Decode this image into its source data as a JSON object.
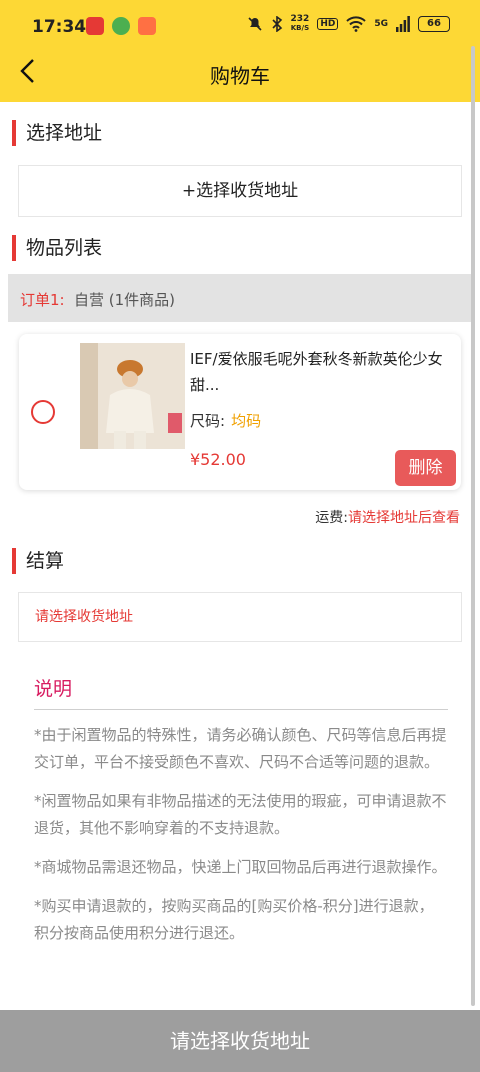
{
  "status_bar": {
    "time": "17:34",
    "net_speed_value": "232",
    "net_speed_unit": "KB/S",
    "hd": "HD",
    "network": "5G",
    "battery": "66",
    "app_icons": [
      "app-red-icon",
      "app-green-icon",
      "app-orange-icon"
    ]
  },
  "nav": {
    "title": "购物车",
    "back_icon": "chevron-left-icon"
  },
  "address_section": {
    "title": "选择地址",
    "select_label": "+选择收货地址"
  },
  "items_section": {
    "title": "物品列表",
    "order": {
      "label": "订单1:",
      "shop": "自营 (1件商品)"
    },
    "items": [
      {
        "name": "IEF/爱依服毛呢外套秋冬新款英伦少女甜...",
        "size_label": "尺码:",
        "size_value": "均码",
        "price": "¥52.00",
        "delete_label": "删除"
      }
    ],
    "shipping_label": "运费:",
    "shipping_value": "请选择地址后查看"
  },
  "checkout_section": {
    "title": "结算",
    "message": "请选择收货地址"
  },
  "notes": {
    "title": "说明",
    "items": [
      "*由于闲置物品的特殊性，请务必确认颜色、尺码等信息后再提交订单，平台不接受颜色不喜欢、尺码不合适等问题的退款。",
      "*闲置物品如果有非物品描述的无法使用的瑕疵，可申请退款不退货，其他不影响穿着的不支持退款。",
      "*商城物品需退还物品，快递上门取回物品后再进行退款操作。",
      "*购买申请退款的，按购买商品的[购买价格-积分]进行退款，积分按商品使用积分进行退还。"
    ]
  },
  "bottom_button": {
    "label": "请选择收货地址"
  },
  "colors": {
    "header": "#fdd835",
    "accent": "#e53935",
    "notes_title": "#d81b60",
    "size_value": "#f0a000",
    "bottom_bar": "#9e9e9e"
  }
}
